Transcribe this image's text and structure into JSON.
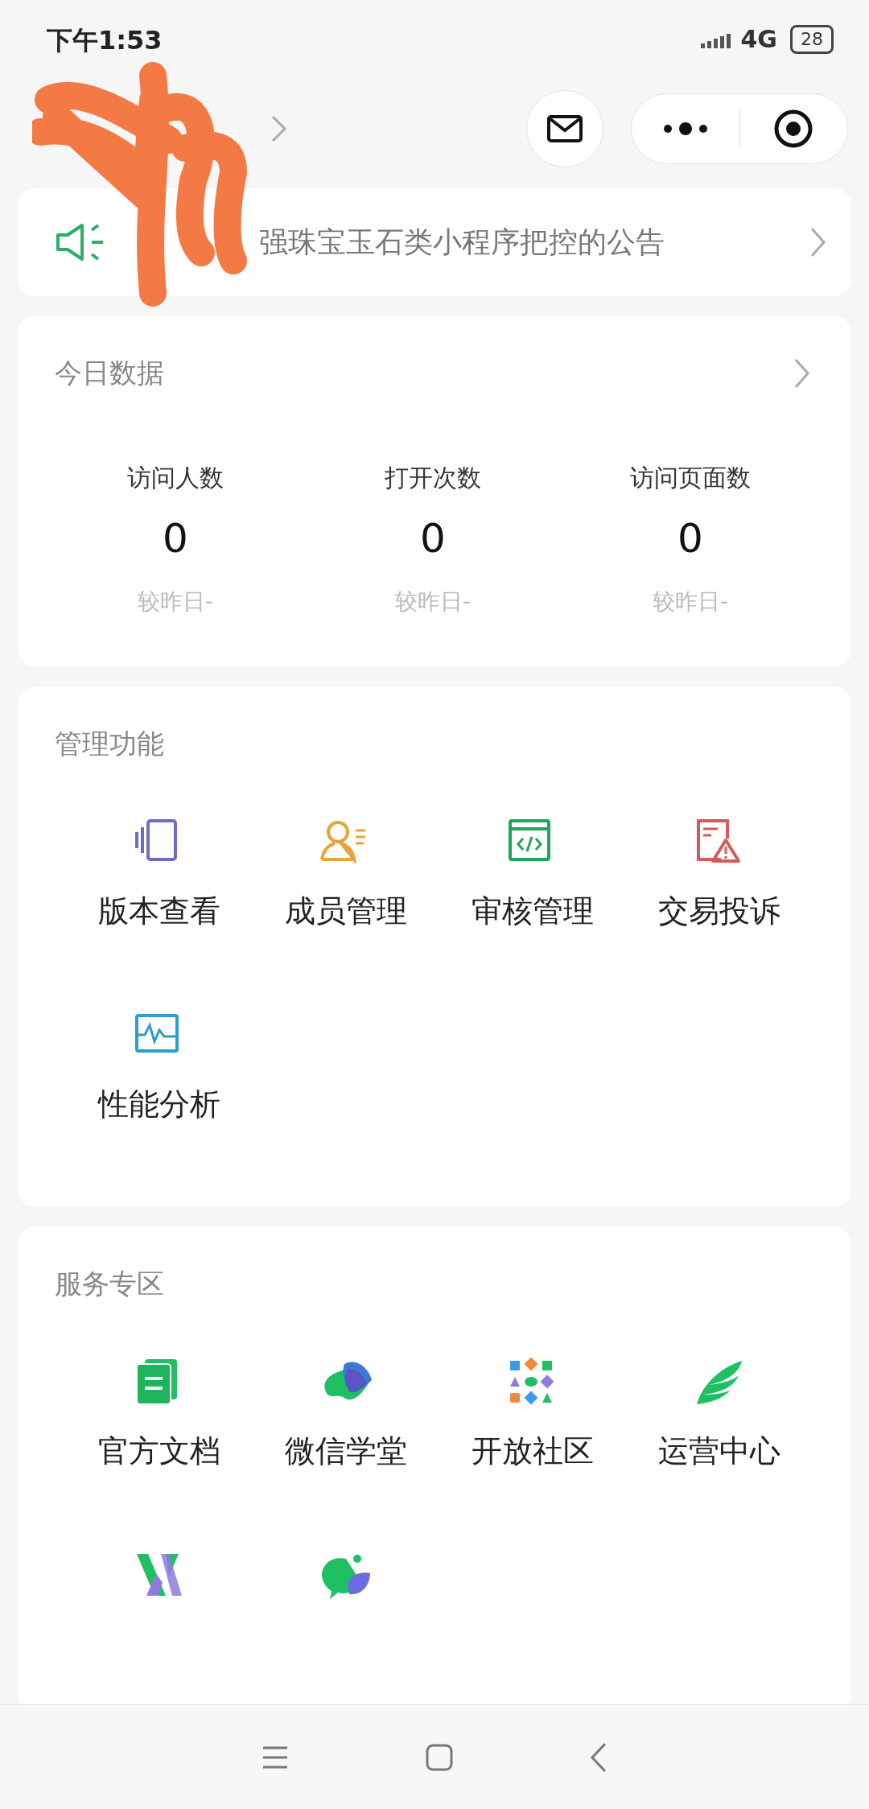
{
  "status_bar": {
    "time": "下午1:53",
    "network": "4G",
    "battery": "28"
  },
  "notice": {
    "text": "强珠宝玉石类小程序把控的公告"
  },
  "today": {
    "title": "今日数据",
    "stats": [
      {
        "label": "访问人数",
        "value": "0",
        "compare": "较昨日-"
      },
      {
        "label": "打开次数",
        "value": "0",
        "compare": "较昨日-"
      },
      {
        "label": "访问页面数",
        "value": "0",
        "compare": "较昨日-"
      }
    ]
  },
  "management": {
    "title": "管理功能",
    "items": [
      {
        "label": "版本查看"
      },
      {
        "label": "成员管理"
      },
      {
        "label": "审核管理"
      },
      {
        "label": "交易投诉"
      },
      {
        "label": "性能分析"
      }
    ]
  },
  "services": {
    "title": "服务专区",
    "items": [
      {
        "kind": "labeled",
        "label": "官方文档"
      },
      {
        "kind": "labeled",
        "label": "微信学堂"
      },
      {
        "kind": "labeled",
        "label": "开放社区"
      },
      {
        "kind": "labeled",
        "label": "运营中心"
      },
      {
        "kind": "icon_only"
      },
      {
        "kind": "icon_only"
      }
    ]
  }
}
